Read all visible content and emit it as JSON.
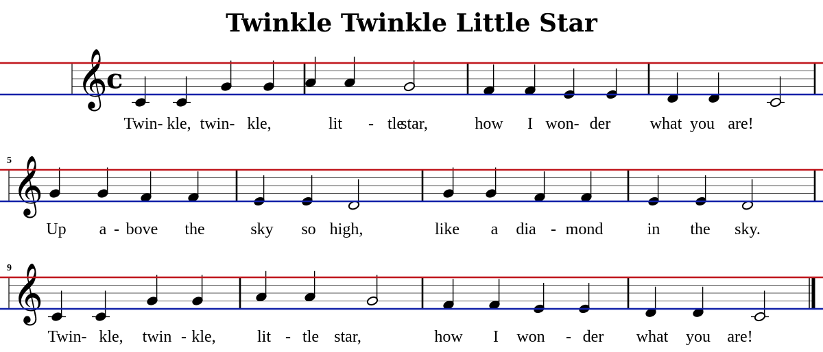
{
  "title": "Twinkle Twinkle Little Star",
  "time_signature": "c",
  "guide_colors": {
    "top": "#c0161c",
    "bottom": "#1020a8"
  },
  "systems": [
    {
      "measure_number": "",
      "notes": [
        {
          "p": "C4",
          "d": "q"
        },
        {
          "p": "C4",
          "d": "q"
        },
        {
          "p": "G4",
          "d": "q"
        },
        {
          "p": "G4",
          "d": "q"
        },
        {
          "p": "A4",
          "d": "q"
        },
        {
          "p": "A4",
          "d": "q"
        },
        {
          "p": "G4",
          "d": "h"
        },
        {
          "p": "F4",
          "d": "q"
        },
        {
          "p": "F4",
          "d": "q"
        },
        {
          "p": "E4",
          "d": "q"
        },
        {
          "p": "E4",
          "d": "q"
        },
        {
          "p": "D4",
          "d": "q"
        },
        {
          "p": "D4",
          "d": "q"
        },
        {
          "p": "C4",
          "d": "h"
        }
      ],
      "lyrics": [
        "Twin-",
        "kle,",
        "twin-",
        "kle,",
        "lit",
        "-",
        "tle",
        "star,",
        "how",
        "I",
        "won-",
        "der",
        "what",
        "you",
        "are!"
      ],
      "final": false
    },
    {
      "measure_number": "5",
      "notes": [
        {
          "p": "G4",
          "d": "q"
        },
        {
          "p": "G4",
          "d": "q"
        },
        {
          "p": "F4",
          "d": "q"
        },
        {
          "p": "F4",
          "d": "q"
        },
        {
          "p": "E4",
          "d": "q"
        },
        {
          "p": "E4",
          "d": "q"
        },
        {
          "p": "D4",
          "d": "h"
        },
        {
          "p": "G4",
          "d": "q"
        },
        {
          "p": "G4",
          "d": "q"
        },
        {
          "p": "F4",
          "d": "q"
        },
        {
          "p": "F4",
          "d": "q"
        },
        {
          "p": "E4",
          "d": "q"
        },
        {
          "p": "E4",
          "d": "q"
        },
        {
          "p": "D4",
          "d": "h"
        }
      ],
      "lyrics": [
        "Up",
        "a",
        "-",
        "bove",
        "the",
        "sky",
        "so",
        "high,",
        "like",
        "a",
        "dia",
        "-",
        "mond",
        "in",
        "the",
        "sky."
      ],
      "final": false
    },
    {
      "measure_number": "9",
      "notes": [
        {
          "p": "C4",
          "d": "q"
        },
        {
          "p": "C4",
          "d": "q"
        },
        {
          "p": "G4",
          "d": "q"
        },
        {
          "p": "G4",
          "d": "q"
        },
        {
          "p": "A4",
          "d": "q"
        },
        {
          "p": "A4",
          "d": "q"
        },
        {
          "p": "G4",
          "d": "h"
        },
        {
          "p": "F4",
          "d": "q"
        },
        {
          "p": "F4",
          "d": "q"
        },
        {
          "p": "E4",
          "d": "q"
        },
        {
          "p": "E4",
          "d": "q"
        },
        {
          "p": "D4",
          "d": "q"
        },
        {
          "p": "D4",
          "d": "q"
        },
        {
          "p": "C4",
          "d": "h"
        }
      ],
      "lyrics": [
        "Twin-",
        "kle,",
        "twin",
        "-",
        "kle,",
        "lit",
        "-",
        "tle",
        "star,",
        "how",
        "I",
        "won",
        "-",
        "der",
        "what",
        "you",
        "are!"
      ],
      "final": true
    }
  ]
}
